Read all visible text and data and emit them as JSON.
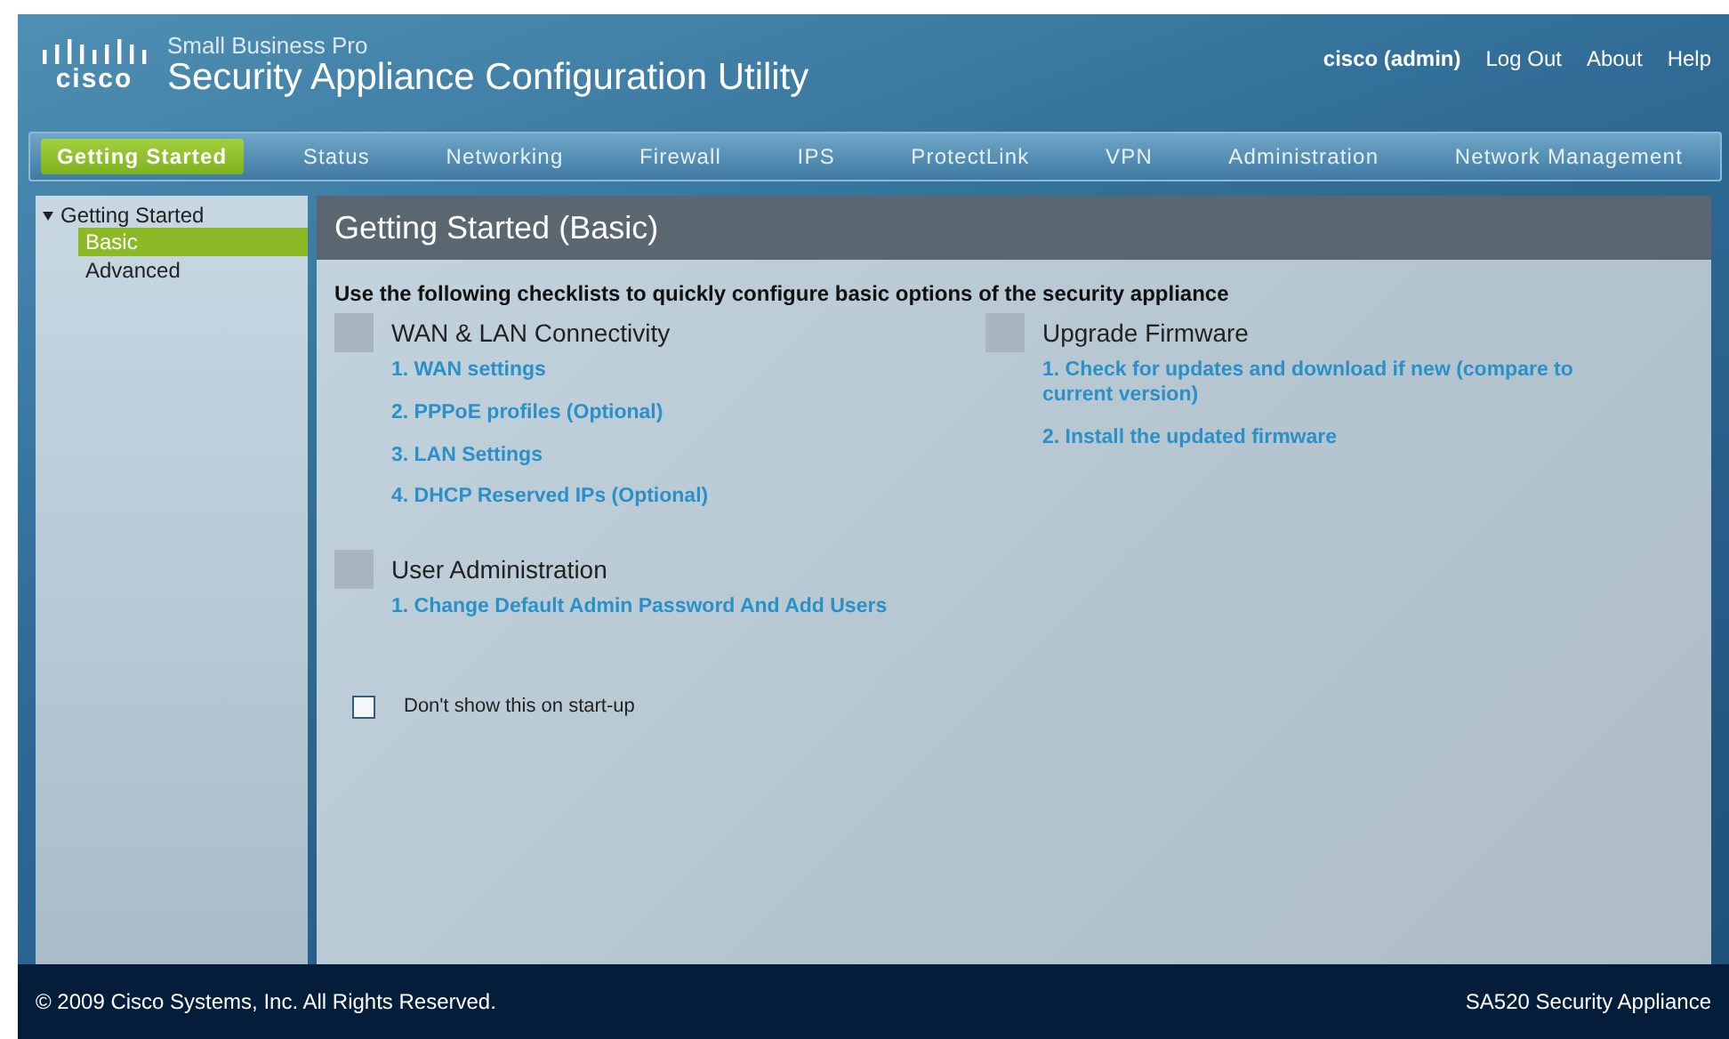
{
  "header": {
    "brand": "cisco",
    "product_line": "Small Business Pro",
    "title": "Security Appliance Configuration Utility",
    "user": "cisco (admin)",
    "links": [
      "Log Out",
      "About",
      "Help"
    ]
  },
  "nav": [
    {
      "label": "Getting Started",
      "selected": true
    },
    {
      "label": "Status",
      "selected": false
    },
    {
      "label": "Networking",
      "selected": false
    },
    {
      "label": "Firewall",
      "selected": false
    },
    {
      "label": "IPS",
      "selected": false
    },
    {
      "label": "ProtectLink",
      "selected": false
    },
    {
      "label": "VPN",
      "selected": false
    },
    {
      "label": "Administration",
      "selected": false
    },
    {
      "label": "Network Management",
      "selected": false
    }
  ],
  "sidebar": {
    "items": [
      {
        "label": "Getting Started",
        "expanded": true,
        "children": [
          {
            "label": "Basic",
            "selected": true
          },
          {
            "label": "Advanced",
            "selected": false
          }
        ]
      }
    ]
  },
  "content": {
    "title": "Getting Started (Basic)",
    "intro": "Use the following checklists to quickly configure basic options of the security appliance",
    "columns": [
      [
        {
          "title": "WAN & LAN Connectivity",
          "links": [
            "1. WAN settings",
            "2. PPPoE profiles (Optional)",
            "3. LAN Settings",
            "4. DHCP Reserved IPs (Optional)"
          ]
        },
        {
          "title": "User Administration",
          "links": [
            "1. Change Default Admin Password And Add Users"
          ]
        }
      ],
      [
        {
          "title": "Upgrade Firmware",
          "links": [
            "1. Check for updates and download if new (compare to current version)",
            "2. Install the updated firmware"
          ]
        }
      ]
    ],
    "startup_checkbox": {
      "label": "Don't show this on start-up",
      "checked": false
    }
  },
  "footer": {
    "copyright": "© 2009 Cisco Systems, Inc. All Rights Reserved.",
    "product": "SA520 Security Appliance"
  }
}
